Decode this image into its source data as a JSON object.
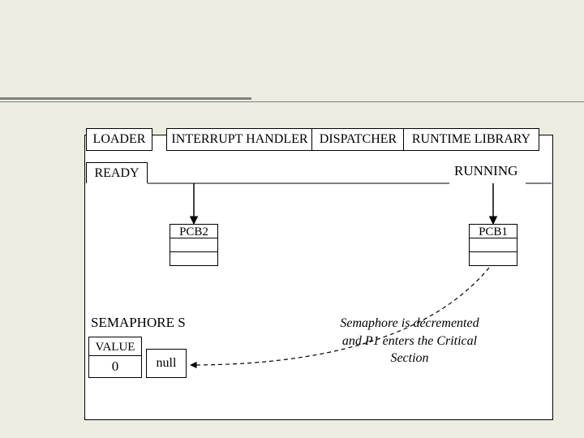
{
  "header_boxes": {
    "loader": "LOADER",
    "interrupt_handler": "INTERRUPT HANDLER",
    "dispatcher": "DISPATCHER",
    "runtime_library": "RUNTIME LIBRARY"
  },
  "queues": {
    "ready": "READY",
    "running": "RUNNING"
  },
  "pcb": {
    "pcb2": "PCB2",
    "pcb1": "PCB1"
  },
  "semaphore": {
    "title": "SEMAPHORE S",
    "value_label": "VALUE",
    "value": "0",
    "ptr": "null"
  },
  "note": {
    "line1": "Semaphore is decremented",
    "line2": "and P1 enters the  Critical",
    "line3": "Section"
  }
}
